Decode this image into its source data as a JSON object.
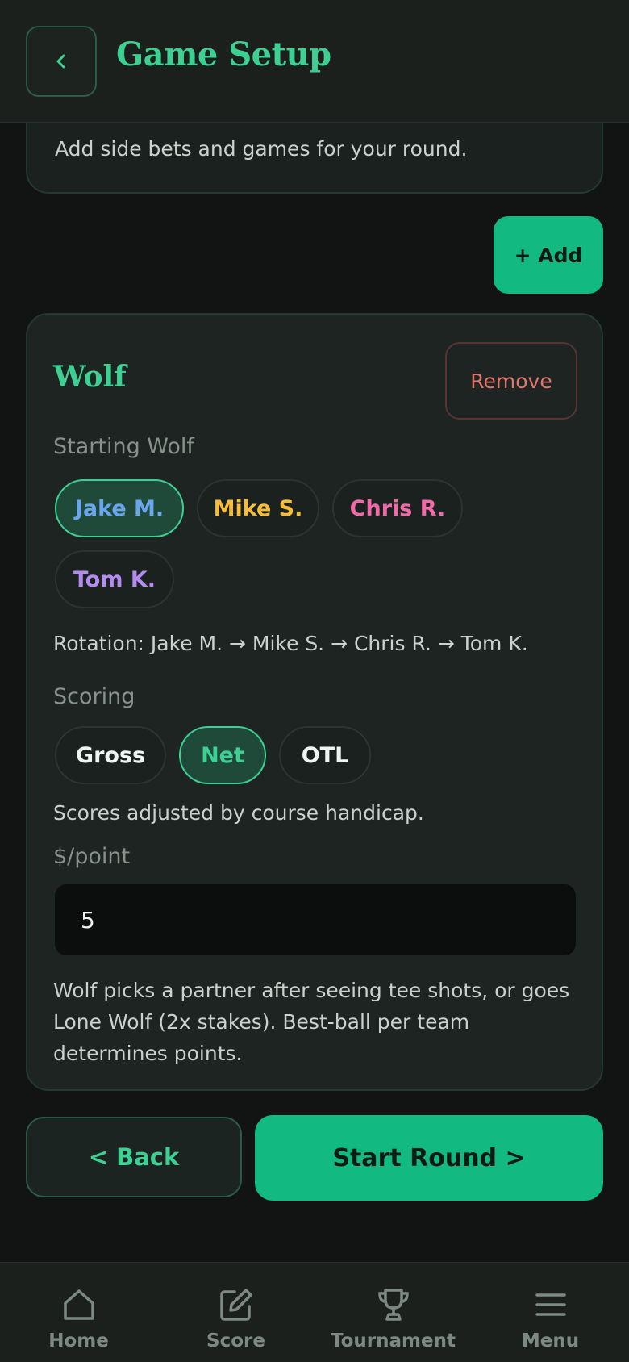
{
  "header": {
    "title": "Game Setup"
  },
  "intro": {
    "text": "Add side bets and games for your round."
  },
  "add_button": "+ Add",
  "game": {
    "name": "Wolf",
    "remove_label": "Remove",
    "starting_label": "Starting Wolf",
    "players": [
      {
        "name": "Jake M.",
        "color": "#6aa6ee",
        "selected": true
      },
      {
        "name": "Mike S.",
        "color": "#f5bd3a",
        "selected": false
      },
      {
        "name": "Chris R.",
        "color": "#f06aa8",
        "selected": false
      },
      {
        "name": "Tom K.",
        "color": "#b48cf0",
        "selected": false
      }
    ],
    "rotation": "Rotation: Jake M. → Mike S. → Chris R. → Tom K.",
    "scoring_label": "Scoring",
    "scoring_options": [
      "Gross",
      "Net",
      "OTL"
    ],
    "scoring_selected": "Net",
    "scoring_note": "Scores adjusted by course handicap.",
    "amount_label": "$/point",
    "amount_value": "5",
    "description": "Wolf picks a partner after seeing tee shots, or goes Lone Wolf (2x stakes). Best-ball per team determines points."
  },
  "footer_buttons": {
    "back": "< Back",
    "start": "Start Round >"
  },
  "nav": [
    {
      "label": "Home",
      "icon": "home-icon"
    },
    {
      "label": "Score",
      "icon": "edit-icon"
    },
    {
      "label": "Tournament",
      "icon": "trophy-icon"
    },
    {
      "label": "Menu",
      "icon": "menu-icon"
    }
  ],
  "colors": {
    "accent": "#3ecf92",
    "primary_button": "#12ba82",
    "danger": "#e0776f"
  }
}
